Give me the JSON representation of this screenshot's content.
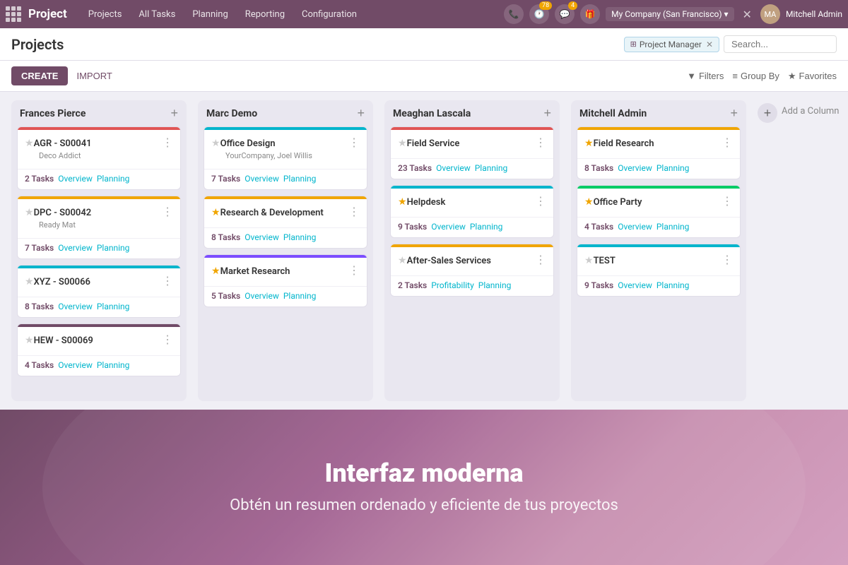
{
  "topnav": {
    "app_title": "Project",
    "menu": [
      "Projects",
      "All Tasks",
      "Planning",
      "Reporting",
      "Configuration"
    ],
    "badge_messages": "78",
    "badge_chat": "4",
    "company": "My Company (San Francisco)",
    "username": "Mitchell Admin"
  },
  "subheader": {
    "title": "Projects",
    "filter_tag": "Project Manager",
    "search_placeholder": "Search..."
  },
  "toolbar": {
    "create_label": "CREATE",
    "import_label": "IMPORT",
    "filters_label": "Filters",
    "groupby_label": "Group By",
    "favorites_label": "Favorites"
  },
  "columns": [
    {
      "id": "col-frances",
      "title": "Frances Pierce",
      "cards": [
        {
          "id": "card-agr",
          "starred": false,
          "title": "AGR - S00041",
          "subtitle": "Deco Addict",
          "task_count": "2 Tasks",
          "links": [
            "Overview",
            "Planning"
          ],
          "color": "#e05555"
        },
        {
          "id": "card-dpc",
          "starred": false,
          "title": "DPC - S00042",
          "subtitle": "Ready Mat",
          "task_count": "7 Tasks",
          "links": [
            "Overview",
            "Planning"
          ],
          "color": "#f0a500"
        },
        {
          "id": "card-xyz",
          "starred": false,
          "title": "XYZ - S00066",
          "subtitle": "",
          "task_count": "8 Tasks",
          "links": [
            "Overview",
            "Planning"
          ],
          "color": "#00b5cc"
        },
        {
          "id": "card-hew",
          "starred": false,
          "title": "HEW - S00069",
          "subtitle": "",
          "task_count": "4 Tasks",
          "links": [
            "Overview",
            "Planning"
          ],
          "color": "#714b67"
        }
      ]
    },
    {
      "id": "col-marc",
      "title": "Marc Demo",
      "cards": [
        {
          "id": "card-office-design",
          "starred": false,
          "title": "Office Design",
          "subtitle": "YourCompany, Joel Willis",
          "task_count": "7 Tasks",
          "links": [
            "Overview",
            "Planning"
          ],
          "color": "#00b5cc"
        },
        {
          "id": "card-rd",
          "starred": true,
          "title": "Research & Development",
          "subtitle": "",
          "task_count": "8 Tasks",
          "links": [
            "Overview",
            "Planning"
          ],
          "color": "#f0a500"
        },
        {
          "id": "card-market",
          "starred": true,
          "title": "Market Research",
          "subtitle": "",
          "task_count": "5 Tasks",
          "links": [
            "Overview",
            "Planning"
          ],
          "color": "#7c4dff"
        }
      ]
    },
    {
      "id": "col-meaghan",
      "title": "Meaghan Lascala",
      "cards": [
        {
          "id": "card-field-service",
          "starred": false,
          "title": "Field Service",
          "subtitle": "",
          "task_count": "23 Tasks",
          "links": [
            "Overview",
            "Planning"
          ],
          "color": "#e05555"
        },
        {
          "id": "card-helpdesk",
          "starred": true,
          "title": "Helpdesk",
          "subtitle": "",
          "task_count": "9 Tasks",
          "links": [
            "Overview",
            "Planning"
          ],
          "color": "#00b5cc"
        },
        {
          "id": "card-after-sales",
          "starred": false,
          "title": "After-Sales Services",
          "subtitle": "",
          "task_count": "2 Tasks",
          "links": [
            "Profitability",
            "Planning"
          ],
          "color": "#f0a500"
        }
      ]
    },
    {
      "id": "col-mitchell",
      "title": "Mitchell Admin",
      "cards": [
        {
          "id": "card-field-research",
          "starred": true,
          "title": "Field Research",
          "subtitle": "",
          "task_count": "8 Tasks",
          "links": [
            "Overview",
            "Planning"
          ],
          "color": "#f0a500"
        },
        {
          "id": "card-office-party",
          "starred": true,
          "title": "Office Party",
          "subtitle": "",
          "task_count": "4 Tasks",
          "links": [
            "Overview",
            "Planning"
          ],
          "color": "#00cc66"
        },
        {
          "id": "card-test",
          "starred": false,
          "title": "TEST",
          "subtitle": "",
          "task_count": "9 Tasks",
          "links": [
            "Overview",
            "Planning"
          ],
          "color": "#00b5cc"
        }
      ]
    }
  ],
  "add_column_label": "Add a Column",
  "promo": {
    "title": "Interfaz moderna",
    "subtitle": "Obtén un resumen ordenado y eficiente de tus proyectos"
  }
}
